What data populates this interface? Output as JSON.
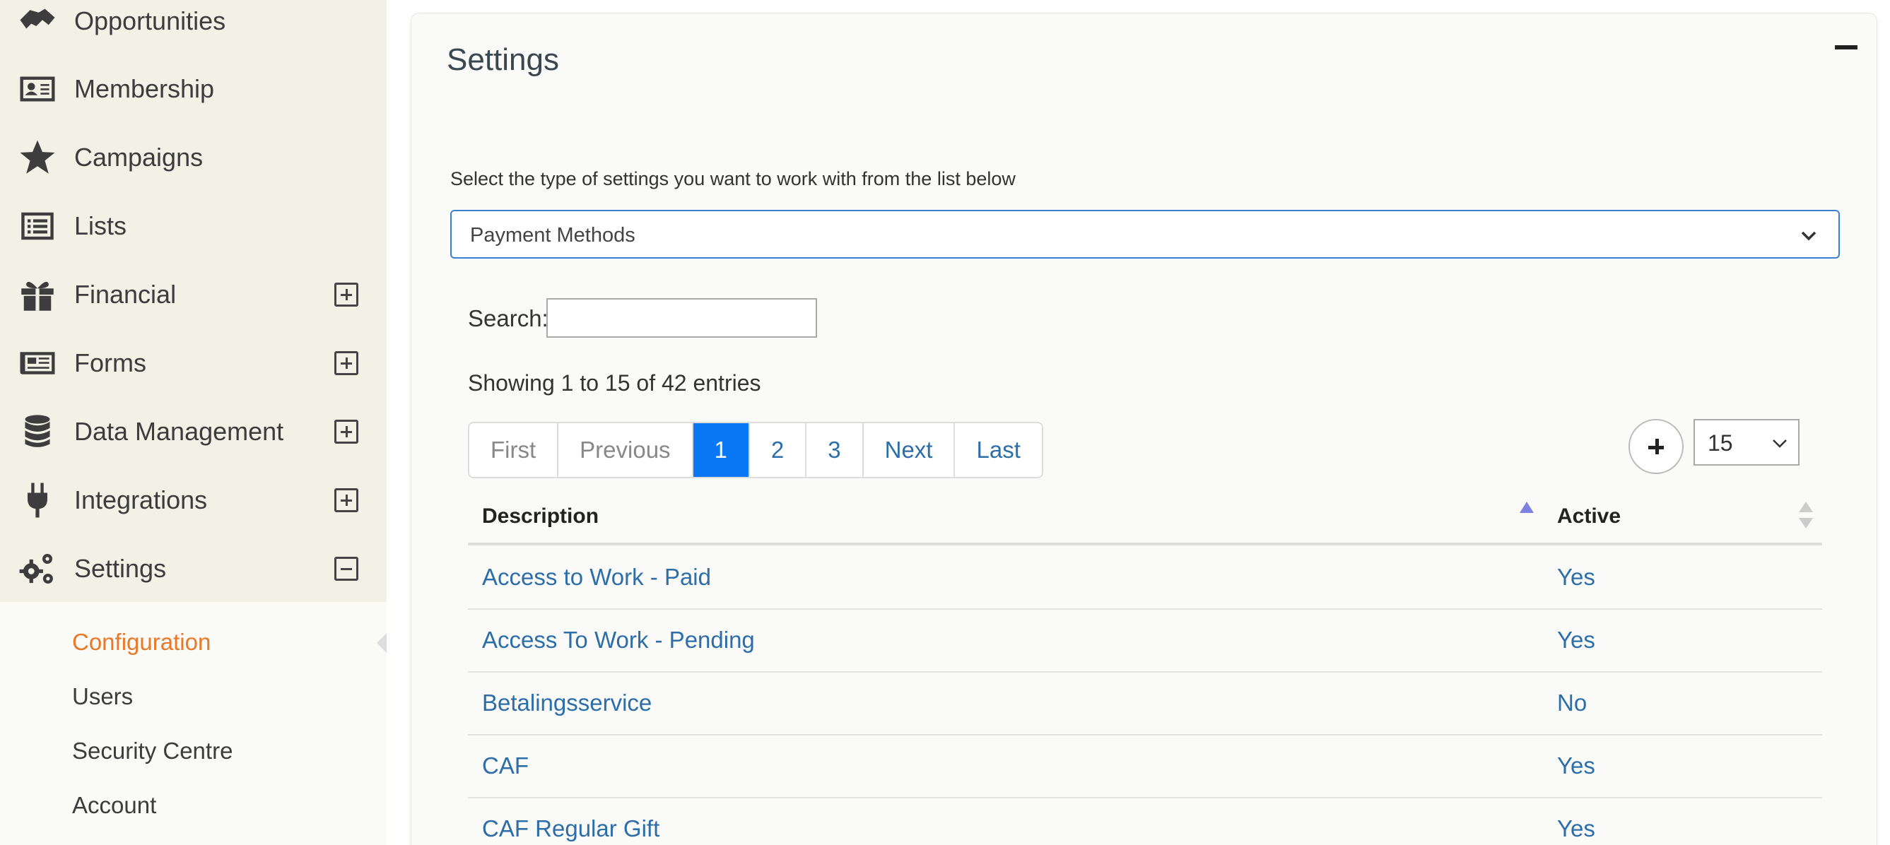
{
  "sidebar": {
    "items": [
      {
        "label": "Opportunities",
        "icon": "handshake-icon",
        "toggle": ""
      },
      {
        "label": "Membership",
        "icon": "id-card-icon",
        "toggle": ""
      },
      {
        "label": "Campaigns",
        "icon": "star-icon",
        "toggle": ""
      },
      {
        "label": "Lists",
        "icon": "list-icon",
        "toggle": ""
      },
      {
        "label": "Financial",
        "icon": "gift-icon",
        "toggle": "plus"
      },
      {
        "label": "Forms",
        "icon": "newspaper-icon",
        "toggle": "plus"
      },
      {
        "label": "Data Management",
        "icon": "database-icon",
        "toggle": "plus"
      },
      {
        "label": "Integrations",
        "icon": "plug-icon",
        "toggle": "plus"
      },
      {
        "label": "Settings",
        "icon": "gears-icon",
        "toggle": "minus"
      }
    ],
    "sub_items": [
      {
        "label": "Configuration",
        "active": true
      },
      {
        "label": "Users",
        "active": false
      },
      {
        "label": "Security Centre",
        "active": false
      },
      {
        "label": "Account",
        "active": false
      }
    ]
  },
  "panel": {
    "title": "Settings",
    "intro": "Select the type of settings you want to work with from the list below",
    "settings_type": "Payment Methods",
    "search_label": "Search:",
    "search_value": "",
    "showing": "Showing 1 to 15 of 42 entries",
    "pager": {
      "first": "First",
      "previous": "Previous",
      "pages": [
        "1",
        "2",
        "3"
      ],
      "current": "1",
      "next": "Next",
      "last": "Last"
    },
    "page_size": "15"
  },
  "table": {
    "columns": [
      "Description",
      "Active"
    ],
    "rows": [
      {
        "description": "Access to Work - Paid",
        "active": "Yes"
      },
      {
        "description": "Access To Work - Pending",
        "active": "Yes"
      },
      {
        "description": "Betalingsservice",
        "active": "No"
      },
      {
        "description": "CAF",
        "active": "Yes"
      },
      {
        "description": "CAF Regular Gift",
        "active": "Yes"
      }
    ]
  },
  "colors": {
    "sidebar_bg": "#f1f1e6",
    "active_link": "#e8782a",
    "link": "#2d6ea8",
    "pager_current": "#0a78f5",
    "select_border": "#3b7fd0"
  }
}
